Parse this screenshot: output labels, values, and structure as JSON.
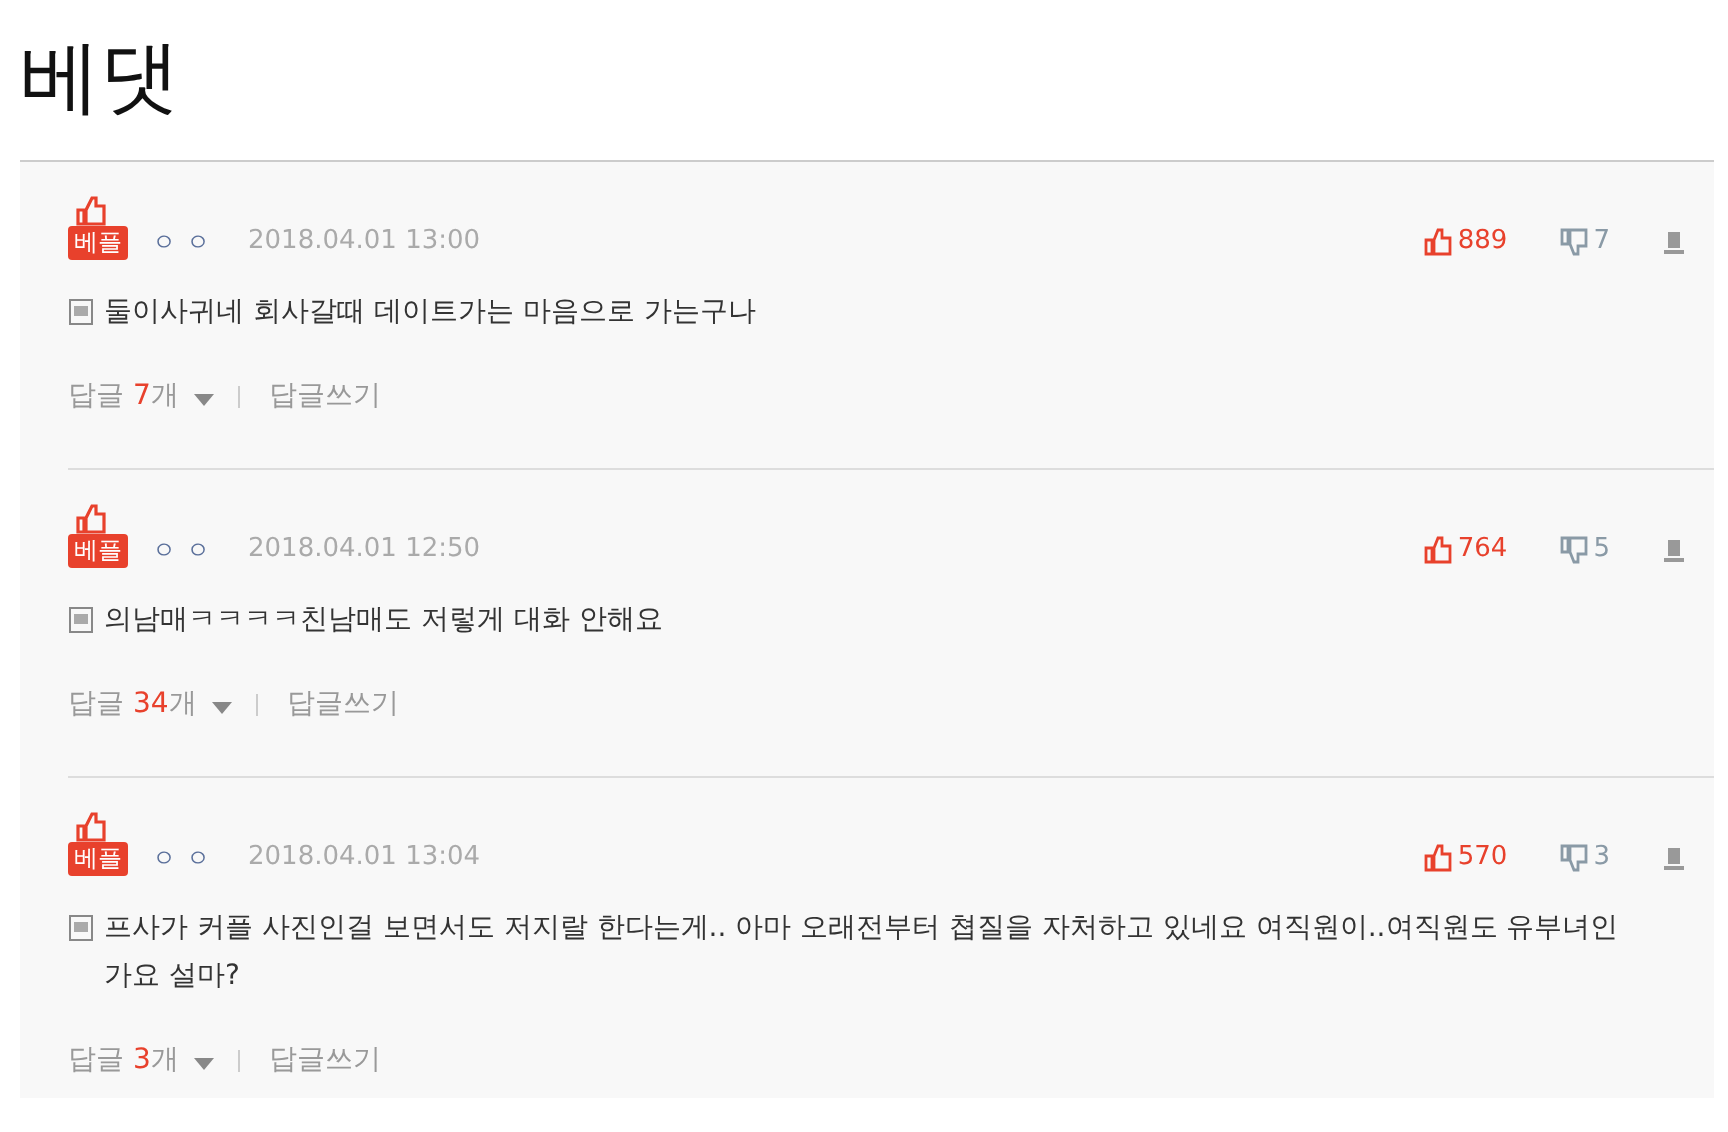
{
  "title": "베댓",
  "comments": [
    {
      "badge": "베플",
      "user": "ㅇㅇ",
      "date": "2018.04.01 13:00",
      "likes": "889",
      "dislikes": "7",
      "text": "둘이사귀네 회사갈때 데이트가는 마음으로 가는구나",
      "reply_label": "답글",
      "reply_count": "7",
      "reply_unit": "개",
      "write_reply": "답글쓰기"
    },
    {
      "badge": "베플",
      "user": "ㅇㅇ",
      "date": "2018.04.01 12:50",
      "likes": "764",
      "dislikes": "5",
      "text": "의남매ㅋㅋㅋㅋ친남매도 저렇게 대화 안해요",
      "reply_label": "답글",
      "reply_count": "34",
      "reply_unit": "개",
      "write_reply": "답글쓰기"
    },
    {
      "badge": "베플",
      "user": "ㅇㅇ",
      "date": "2018.04.01 13:04",
      "likes": "570",
      "dislikes": "3",
      "text": "프사가 커플 사진인걸 보면서도 저지랄 한다는게.. 아마 오래전부터 쳡질을 자처하고 있네요 여직원이..여직원도 유부녀인가요 설마?",
      "reply_label": "답글",
      "reply_count": "3",
      "reply_unit": "개",
      "write_reply": "답글쓰기"
    }
  ]
}
